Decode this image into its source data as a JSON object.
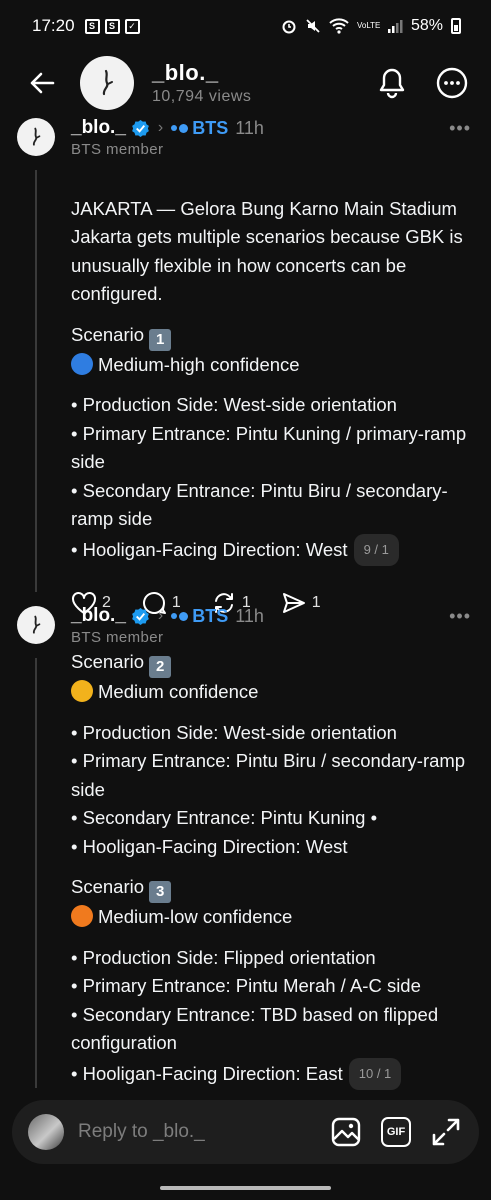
{
  "status_bar": {
    "time": "17:20",
    "left_icons": [
      "s-app-icon",
      "s-app-icon",
      "checkbox-icon"
    ],
    "right_icons": [
      "alarm-icon",
      "mute-icon",
      "wifi-icon",
      "volte-icon",
      "signal-icon"
    ],
    "volte_label": "VoLTE",
    "battery": "58%"
  },
  "header": {
    "title": "_blo._",
    "views": "10,794 views"
  },
  "posts": [
    {
      "username": "_blo._",
      "community": "BTS",
      "time": "11h",
      "badge": "BTS member",
      "intro": "JAKARTA — Gelora Bung Karno Main Stadium Jakarta gets multiple scenarios because GBK is unusually flexible in how concerts can be configured.",
      "scenario_label": "Scenario",
      "scenario_number": "1",
      "confidence": "Medium-high confidence",
      "confidence_color": "#2f7de1",
      "lines": [
        "• Production Side: West-side orientation",
        "• Primary Entrance: Pintu Kuning / primary-ramp side",
        "• Secondary Entrance: Pintu Biru / secondary-ramp side",
        "• Hooligan-Facing Direction: West"
      ],
      "counter": "9 / 1",
      "likes": "2",
      "replies": "1",
      "reposts": "1",
      "shares": "1"
    },
    {
      "username": "_blo._",
      "community": "BTS",
      "time": "11h",
      "badge": "BTS member",
      "scenario_a_label": "Scenario",
      "scenario_a_number": "2",
      "confidence_a": "Medium confidence",
      "confidence_a_color": "#f2b21c",
      "lines_a": [
        "• Production Side: West-side orientation",
        "• Primary Entrance: Pintu Biru / secondary-ramp side",
        "• Secondary Entrance: Pintu Kuning •",
        "• Hooligan-Facing Direction: West"
      ],
      "scenario_b_label": "Scenario",
      "scenario_b_number": "3",
      "confidence_b": "Medium-low confidence",
      "confidence_b_color": "#f07a1e",
      "lines_b": [
        "•  Production Side: Flipped orientation",
        "• Primary Entrance: Pintu Merah / A-C side",
        "• Secondary Entrance: TBD based on flipped configuration",
        "• Hooligan-Facing Direction: East"
      ],
      "counter": "10 / 1"
    }
  ],
  "reply_bar": {
    "placeholder": "Reply to _blo._",
    "gif_label": "GIF"
  }
}
